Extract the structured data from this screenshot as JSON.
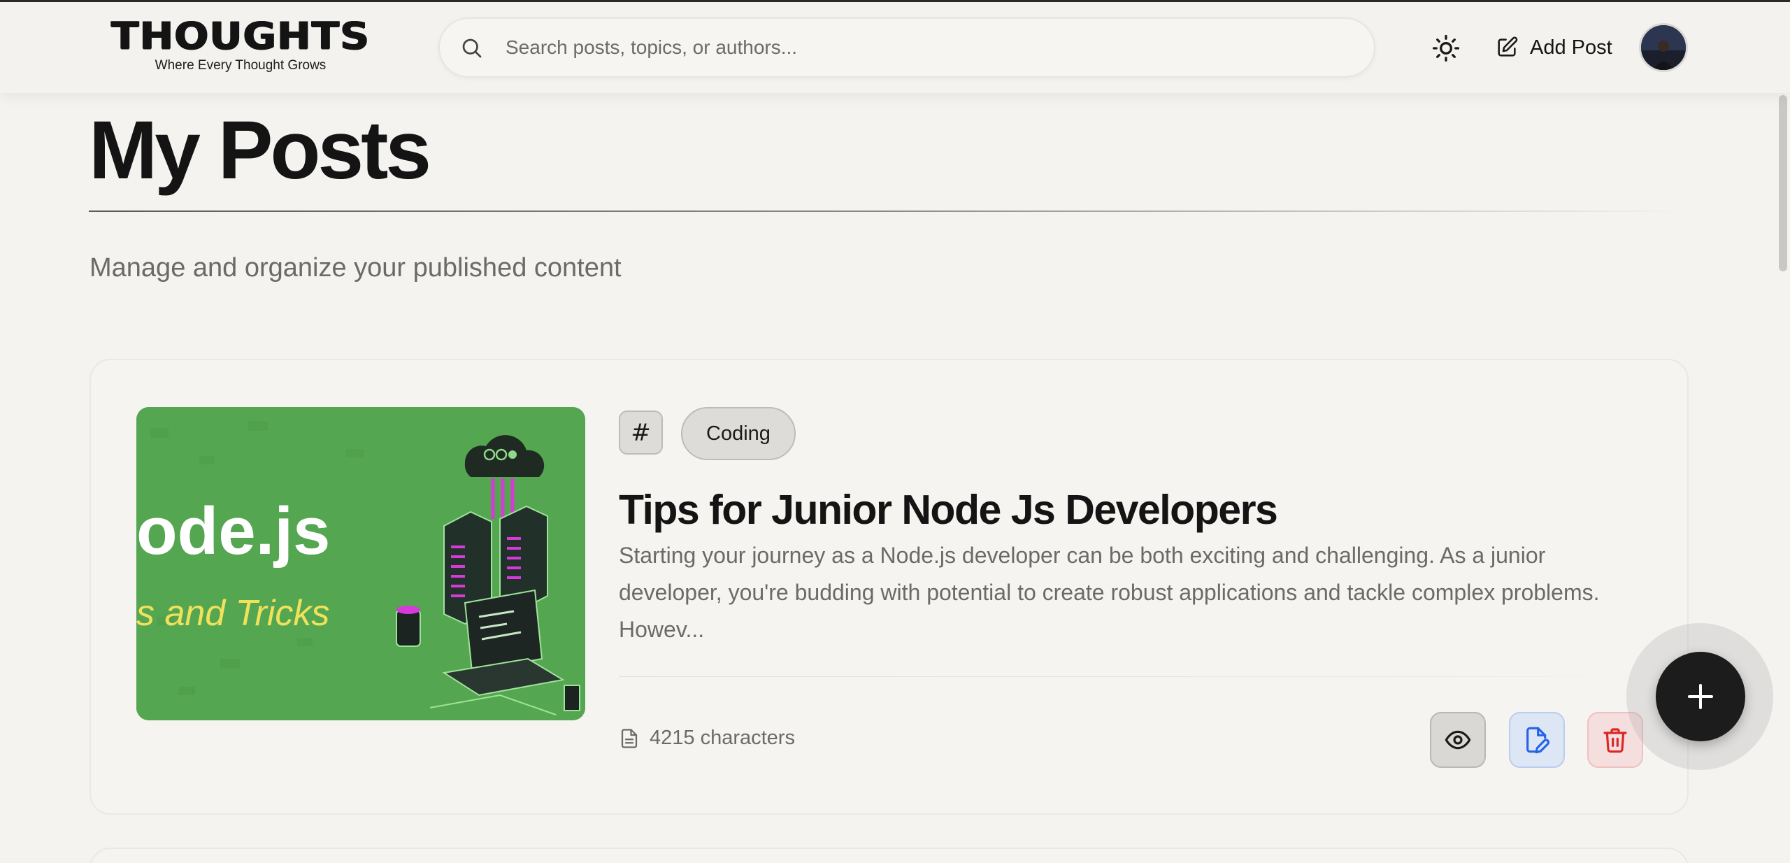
{
  "brand": {
    "name": "THOUGHTS",
    "tagline": "Where Every Thought Grows"
  },
  "header": {
    "search": {
      "placeholder": "Search posts, topics, or authors...",
      "value": ""
    },
    "theme_toggle_icon": "sun-icon",
    "add_post_label": "Add Post",
    "add_post_icon": "edit-square-icon",
    "avatar_icon": "user-avatar"
  },
  "page": {
    "title": "My Posts",
    "subtitle": "Manage and organize your published content"
  },
  "posts": [
    {
      "tag_symbol": "#",
      "tag": "Coding",
      "title": "Tips for Junior Node Js Developers",
      "excerpt": "Starting your journey as a Node.js developer can be both exciting and challenging. As a junior developer, you're budding with potential to create robust applications and tackle complex problems. Howev...",
      "meta_icon": "document-icon",
      "char_count_text": "4215 characters",
      "thumbnail": {
        "text_line1": "ode.js",
        "text_line2": "s and Tricks",
        "bg_color": "#55a651",
        "accent_color": "#f2e15a"
      },
      "actions": [
        {
          "name": "view",
          "icon": "eye-icon",
          "color": "#1a1a1a"
        },
        {
          "name": "edit",
          "icon": "edit-file-icon",
          "color": "#2563eb"
        },
        {
          "name": "delete",
          "icon": "trash-icon",
          "color": "#dc2626"
        }
      ]
    }
  ],
  "fab_icon": "plus-icon",
  "colors": {
    "background": "#f4f3f0",
    "text": "#141414",
    "muted": "#6a6a6a",
    "edit_blue": "#2563eb",
    "delete_red": "#dc2626"
  }
}
